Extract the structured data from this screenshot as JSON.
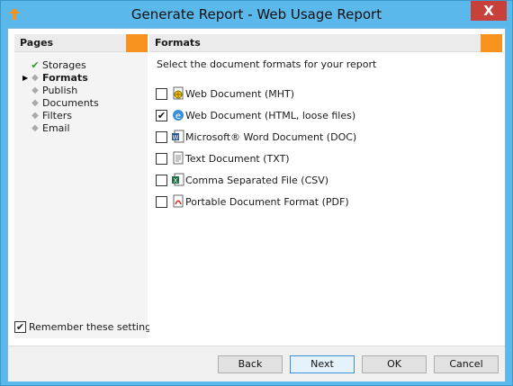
{
  "window": {
    "title": "Generate Report - Web Usage Report",
    "close_label": "X"
  },
  "sidebar": {
    "title": "Pages",
    "items": [
      {
        "label": "Storages",
        "state": "completed"
      },
      {
        "label": "Formats",
        "state": "current"
      },
      {
        "label": "Publish",
        "state": "pending"
      },
      {
        "label": "Documents",
        "state": "pending"
      },
      {
        "label": "Filters",
        "state": "pending"
      },
      {
        "label": "Email",
        "state": "pending"
      }
    ],
    "remember_label": "Remember these settings",
    "remember_checked": true
  },
  "formats": {
    "title": "Formats",
    "instructions": "Select the document formats for your report",
    "items": [
      {
        "label": "Web Document (MHT)",
        "checked": false,
        "icon": "mht-icon"
      },
      {
        "label": "Web Document (HTML, loose files)",
        "checked": true,
        "icon": "html-icon"
      },
      {
        "label": "Microsoft® Word Document (DOC)",
        "checked": false,
        "icon": "word-icon"
      },
      {
        "label": "Text Document (TXT)",
        "checked": false,
        "icon": "text-icon"
      },
      {
        "label": "Comma Separated File (CSV)",
        "checked": false,
        "icon": "csv-icon"
      },
      {
        "label": "Portable Document Format (PDF)",
        "checked": false,
        "icon": "pdf-icon"
      }
    ]
  },
  "buttons": {
    "back": "Back",
    "next": "Next",
    "ok": "OK",
    "cancel": "Cancel"
  },
  "colors": {
    "title_bar": "#5bb8ea",
    "accent": "#f7931e",
    "close": "#c7403a",
    "check_mark": "#2d9c2d"
  }
}
